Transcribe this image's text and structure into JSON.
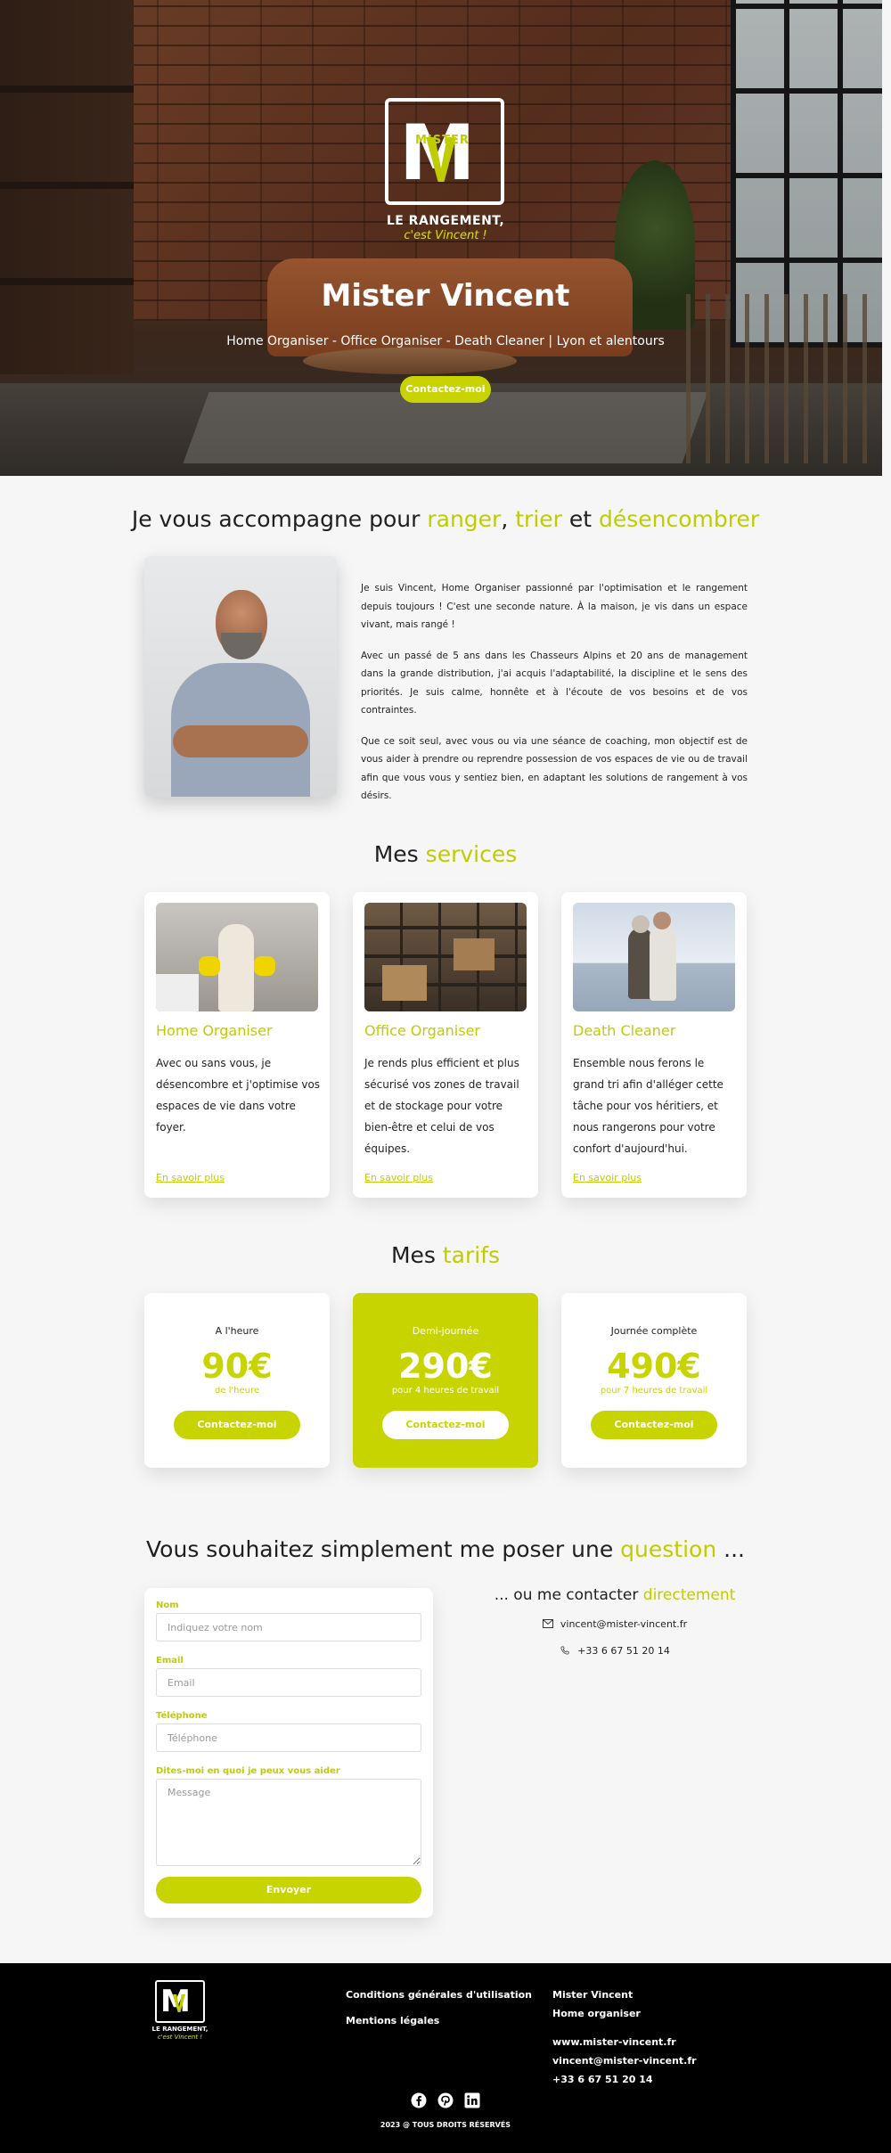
{
  "hero": {
    "logo_mister": "MISTER",
    "logo_tagline_1": "LE RANGEMENT,",
    "logo_tagline_2": "c'est Vincent !",
    "title": "Mister Vincent",
    "subtitle": "Home Organiser - Office Organiser - Death Cleaner | Lyon et alentours",
    "cta": "Contactez-moi"
  },
  "about": {
    "heading_pre": "Je vous accompagne pour ",
    "heading_w1": "ranger",
    "heading_sep1": ", ",
    "heading_w2": "trier",
    "heading_sep2": " et ",
    "heading_w3": "désencombrer",
    "paragraphs": [
      "Je suis Vincent, Home Organiser passionné par l'optimisation et le rangement depuis toujours ! C'est une seconde nature. À la maison, je vis dans un espace vivant, mais rangé !",
      "Avec un passé de 5 ans dans les Chasseurs Alpins et 20 ans de management dans la grande distribution, j'ai acquis l'adaptabilité, la discipline et le sens des priorités. Je suis calme, honnête et à l'écoute de vos besoins et de vos contraintes.",
      "Que ce soit seul, avec vous ou via une séance de coaching, mon objectif est de vous aider à prendre ou reprendre possession de vos espaces de vie ou de travail afin que vous vous y sentiez bien, en adaptant les solutions de rangement à vos désirs."
    ]
  },
  "services": {
    "heading_pre": "Mes ",
    "heading_accent": "services",
    "items": [
      {
        "title": "Home Organiser",
        "desc": "Avec ou sans vous, je désencombre et j'optimise vos espaces de vie dans votre foyer.",
        "link": "En savoir plus"
      },
      {
        "title": "Office Organiser",
        "desc": "Je rends plus efficient et plus sécurisé vos zones de travail et de stockage pour votre bien-être et celui de vos équipes.",
        "link": "En savoir plus"
      },
      {
        "title": "Death Cleaner",
        "desc": "Ensemble nous ferons le grand tri afin d'alléger cette tâche pour vos héritiers, et nous rangerons pour votre confort d'aujourd'hui.",
        "link": "En savoir plus"
      }
    ]
  },
  "pricing": {
    "heading_pre": "Mes ",
    "heading_accent": "tarifs",
    "items": [
      {
        "label": "A l'heure",
        "value": "90€",
        "unit": "de l'heure",
        "button": "Contactez-moi"
      },
      {
        "label": "Demi-journée",
        "value": "290€",
        "unit": "pour 4 heures de travail",
        "button": "Contactez-moi"
      },
      {
        "label": "Journée complète",
        "value": "490€",
        "unit": "pour 7 heures de travail",
        "button": "Contactez-moi"
      }
    ]
  },
  "contact": {
    "heading_pre": "Vous souhaitez simplement me poser une ",
    "heading_accent": "question",
    "heading_post": " ...",
    "form": {
      "name_label": "Nom",
      "name_placeholder": "Indiquez votre nom",
      "email_label": "Email",
      "email_placeholder": "Email",
      "phone_label": "Téléphone",
      "phone_placeholder": "Téléphone",
      "message_label": "Dites-moi en quoi je peux vous aider",
      "message_placeholder": "Message",
      "submit": "Envoyer"
    },
    "direct_pre": "... ou me contacter ",
    "direct_accent": "directement",
    "email": "vincent@mister-vincent.fr",
    "phone": "+33 6 67 51 20 14"
  },
  "footer": {
    "logo_mister": "MISTER",
    "tagline_1": "LE RANGEMENT,",
    "tagline_2": "c'est Vincent !",
    "links": [
      "Conditions générales d'utilisation",
      "Mentions légales"
    ],
    "info": [
      "Mister Vincent",
      "Home organiser",
      "www.mister-vincent.fr",
      "vincent@mister-vincent.fr",
      "+33 6 67 51 20 14"
    ],
    "social_icons": [
      "facebook-icon",
      "pinterest-icon",
      "linkedin-icon"
    ],
    "copyright": "2023 @ TOUS DROITS RÉSERVÉS"
  },
  "colors": {
    "accent": "#c7d400",
    "footer_bg": "#000000",
    "page_bg": "#f6f6f6"
  }
}
